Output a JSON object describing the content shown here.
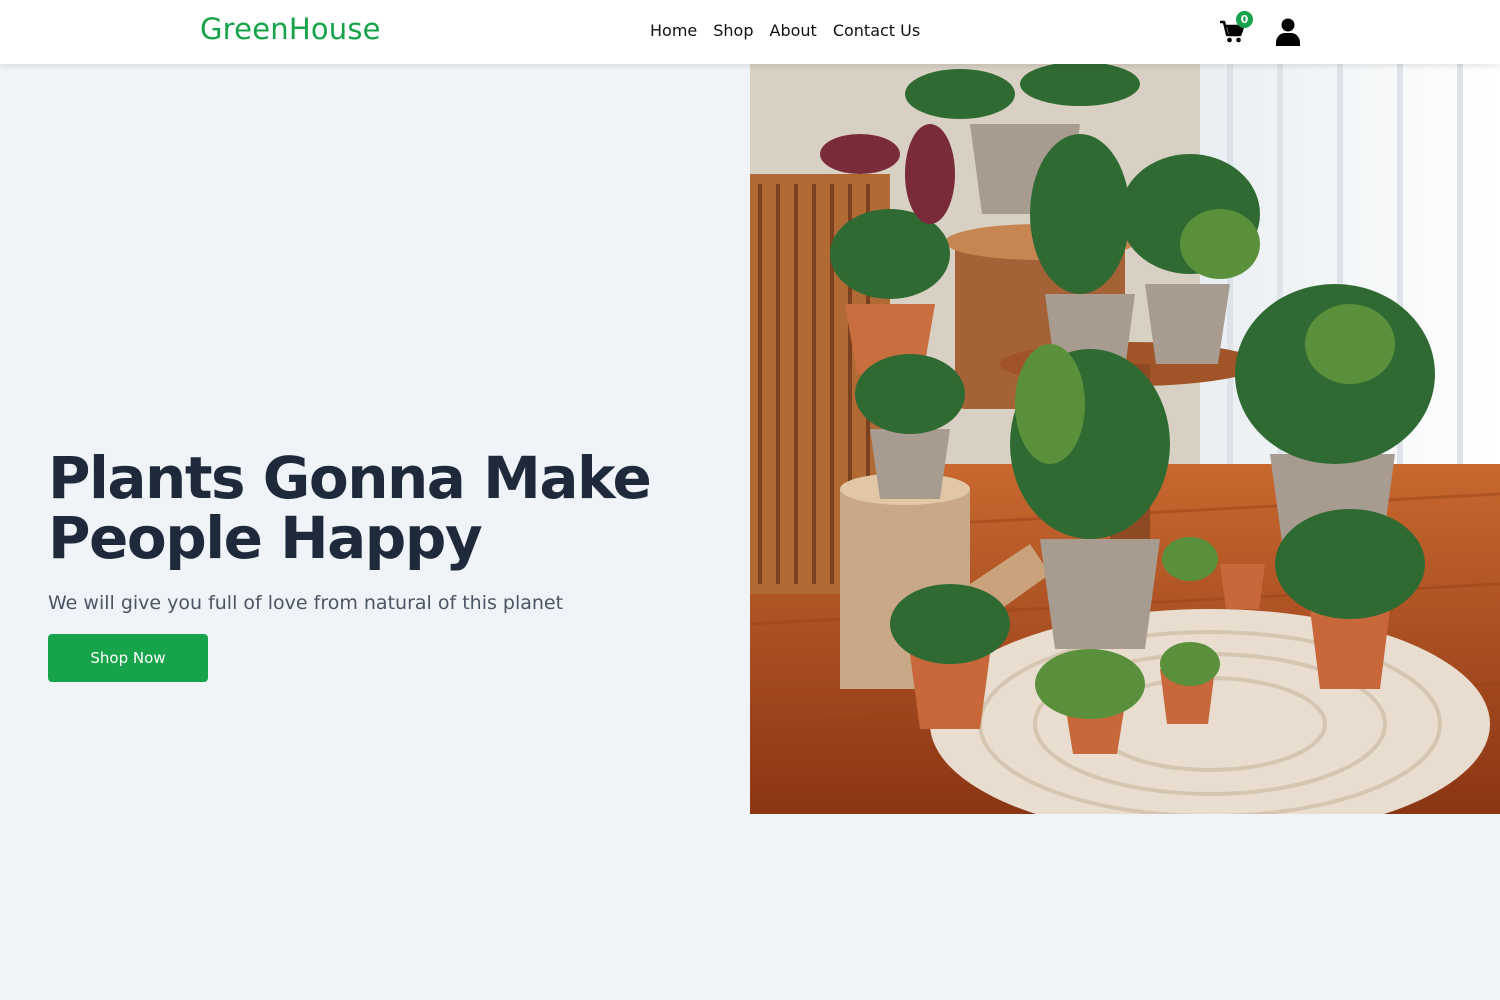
{
  "navbar": {
    "logo": "GreenHouse",
    "links": [
      "Home",
      "Shop",
      "About",
      "Contact Us"
    ],
    "cart_count": "0",
    "cart_icon": "shopping-cart-icon",
    "user_icon": "user-icon"
  },
  "hero": {
    "headline_line1": "Plants Gonna Make",
    "headline_line2": "People Happy",
    "subtext": "We will give you full of love from natural of this planet",
    "cta_label": "Shop Now"
  },
  "colors": {
    "brand": "#16a34a",
    "background": "#f0f4f8",
    "headline": "#1e293b"
  }
}
